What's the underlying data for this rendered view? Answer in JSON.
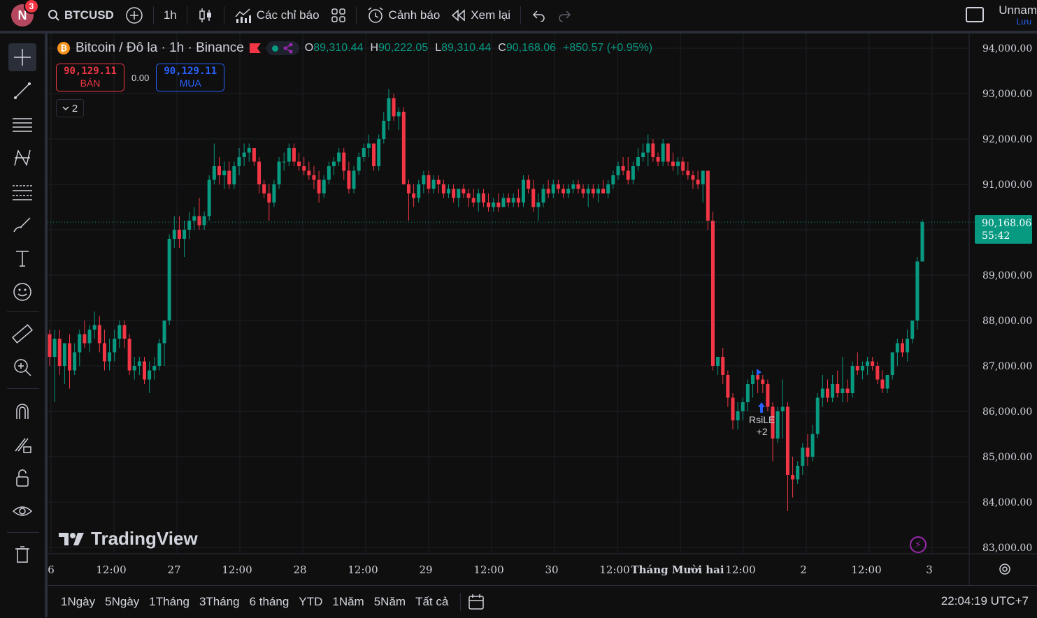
{
  "topbar": {
    "avatar_letter": "N",
    "notif_count": "3",
    "symbol": "BTCUSD",
    "interval": "1h",
    "indicators_label": "Các chỉ báo",
    "alerts_label": "Cảnh báo",
    "replay_label": "Xem lại",
    "user_name": "Unnam",
    "save_label": "Lưu"
  },
  "legend": {
    "title": "Bitcoin / Đô la · 1h · Binance",
    "logo_letter": "₿",
    "o_key": "O",
    "o_val": "89,310.44",
    "h_key": "H",
    "h_val": "90,222.05",
    "l_key": "L",
    "l_val": "89,310.44",
    "c_key": "C",
    "c_val": "90,168.06",
    "change": "+850.57 (+0.95%)"
  },
  "trade": {
    "sell_price": "90,129.11",
    "sell_label": "BÁN",
    "spread": "0.00",
    "buy_price": "90,129.11",
    "buy_label": "MUA",
    "collapse_count": "2"
  },
  "price_axis": [
    "94,000.00",
    "93,000.00",
    "92,000.00",
    "91,000.00",
    "89,000.00",
    "88,000.00",
    "87,000.00",
    "86,000.00",
    "85,000.00",
    "84,000.00",
    "83,000.00"
  ],
  "last_price": {
    "price": "90,168.06",
    "countdown": "55:42"
  },
  "time_axis": [
    "6",
    "12:00",
    "27",
    "12:00",
    "28",
    "12:00",
    "29",
    "12:00",
    "30",
    "12:00",
    "Tháng Mười hai",
    "12:00",
    "2",
    "12:00",
    "3"
  ],
  "strategy_label": {
    "name": "RsiLE",
    "more": "+2"
  },
  "watermark": "TradingView",
  "ranges": [
    "1Ngày",
    "5Ngày",
    "1Tháng",
    "3Tháng",
    "6 tháng",
    "YTD",
    "1Năm",
    "5Năm",
    "Tất cả"
  ],
  "clock": "22:04:19 UTC+7",
  "colors": {
    "up": "#089981",
    "down": "#f23645",
    "accent": "#2962ff",
    "background": "#0f0f0f"
  },
  "chart_data": {
    "type": "candlestick",
    "ylim": [
      82800,
      94300
    ],
    "series": [
      {
        "o": 87700,
        "h": 87800,
        "l": 87000,
        "c": 87200
      },
      {
        "o": 87200,
        "h": 87800,
        "l": 86200,
        "c": 87600
      },
      {
        "o": 87600,
        "h": 87800,
        "l": 86800,
        "c": 87000
      },
      {
        "o": 87000,
        "h": 87400,
        "l": 86600,
        "c": 87500
      },
      {
        "o": 87500,
        "h": 87700,
        "l": 86500,
        "c": 86900
      },
      {
        "o": 86900,
        "h": 87500,
        "l": 86800,
        "c": 87300
      },
      {
        "o": 87300,
        "h": 87800,
        "l": 87000,
        "c": 87700
      },
      {
        "o": 87700,
        "h": 88000,
        "l": 87400,
        "c": 87500
      },
      {
        "o": 87500,
        "h": 87900,
        "l": 87300,
        "c": 87800
      },
      {
        "o": 87800,
        "h": 88200,
        "l": 87600,
        "c": 87900
      },
      {
        "o": 87900,
        "h": 88100,
        "l": 87300,
        "c": 87500
      },
      {
        "o": 87500,
        "h": 87800,
        "l": 86900,
        "c": 87100
      },
      {
        "o": 87100,
        "h": 87600,
        "l": 86900,
        "c": 87300
      },
      {
        "o": 87300,
        "h": 87800,
        "l": 87100,
        "c": 87600
      },
      {
        "o": 87600,
        "h": 88000,
        "l": 87400,
        "c": 87900
      },
      {
        "o": 87900,
        "h": 88000,
        "l": 87400,
        "c": 87600
      },
      {
        "o": 87600,
        "h": 87700,
        "l": 86800,
        "c": 86900
      },
      {
        "o": 86900,
        "h": 87200,
        "l": 86700,
        "c": 87000
      },
      {
        "o": 87000,
        "h": 87200,
        "l": 86800,
        "c": 87100
      },
      {
        "o": 87100,
        "h": 87200,
        "l": 86600,
        "c": 86700
      },
      {
        "o": 86700,
        "h": 87100,
        "l": 86400,
        "c": 86900
      },
      {
        "o": 86900,
        "h": 87200,
        "l": 86700,
        "c": 87000
      },
      {
        "o": 87000,
        "h": 87600,
        "l": 86900,
        "c": 87500
      },
      {
        "o": 87500,
        "h": 88000,
        "l": 87000,
        "c": 88000
      },
      {
        "o": 88000,
        "h": 89900,
        "l": 87900,
        "c": 89800
      },
      {
        "o": 89800,
        "h": 90300,
        "l": 89600,
        "c": 90000
      },
      {
        "o": 90000,
        "h": 90300,
        "l": 89600,
        "c": 89800
      },
      {
        "o": 89800,
        "h": 90200,
        "l": 89400,
        "c": 90000
      },
      {
        "o": 90000,
        "h": 90400,
        "l": 89800,
        "c": 90200
      },
      {
        "o": 90200,
        "h": 90500,
        "l": 90000,
        "c": 90300
      },
      {
        "o": 90300,
        "h": 90700,
        "l": 90000,
        "c": 90100
      },
      {
        "o": 90100,
        "h": 90400,
        "l": 90000,
        "c": 90300
      },
      {
        "o": 90300,
        "h": 91200,
        "l": 90200,
        "c": 91100
      },
      {
        "o": 91100,
        "h": 91900,
        "l": 91000,
        "c": 91400
      },
      {
        "o": 91400,
        "h": 91600,
        "l": 91000,
        "c": 91200
      },
      {
        "o": 91200,
        "h": 91500,
        "l": 90900,
        "c": 91300
      },
      {
        "o": 91300,
        "h": 91500,
        "l": 90900,
        "c": 91000
      },
      {
        "o": 91000,
        "h": 91500,
        "l": 90900,
        "c": 91400
      },
      {
        "o": 91400,
        "h": 91800,
        "l": 91200,
        "c": 91600
      },
      {
        "o": 91600,
        "h": 91900,
        "l": 91400,
        "c": 91700
      },
      {
        "o": 91700,
        "h": 91900,
        "l": 91500,
        "c": 91800
      },
      {
        "o": 91800,
        "h": 91800,
        "l": 91400,
        "c": 91500
      },
      {
        "o": 91500,
        "h": 91600,
        "l": 90800,
        "c": 91000
      },
      {
        "o": 91000,
        "h": 91100,
        "l": 90700,
        "c": 90800
      },
      {
        "o": 90800,
        "h": 91000,
        "l": 90200,
        "c": 90600
      },
      {
        "o": 90600,
        "h": 91100,
        "l": 90500,
        "c": 91000
      },
      {
        "o": 91000,
        "h": 91600,
        "l": 90900,
        "c": 91500
      },
      {
        "o": 91500,
        "h": 91700,
        "l": 91300,
        "c": 91500
      },
      {
        "o": 91500,
        "h": 91900,
        "l": 91400,
        "c": 91800
      },
      {
        "o": 91800,
        "h": 91900,
        "l": 91400,
        "c": 91500
      },
      {
        "o": 91500,
        "h": 91700,
        "l": 91300,
        "c": 91400
      },
      {
        "o": 91400,
        "h": 91600,
        "l": 91200,
        "c": 91300
      },
      {
        "o": 91300,
        "h": 91500,
        "l": 91100,
        "c": 91200
      },
      {
        "o": 91200,
        "h": 91400,
        "l": 90900,
        "c": 91100
      },
      {
        "o": 91100,
        "h": 91300,
        "l": 90600,
        "c": 90800
      },
      {
        "o": 90800,
        "h": 91200,
        "l": 90700,
        "c": 91100
      },
      {
        "o": 91100,
        "h": 91500,
        "l": 91000,
        "c": 91400
      },
      {
        "o": 91400,
        "h": 91600,
        "l": 91200,
        "c": 91500
      },
      {
        "o": 91500,
        "h": 91800,
        "l": 91400,
        "c": 91700
      },
      {
        "o": 91700,
        "h": 91800,
        "l": 91100,
        "c": 91300
      },
      {
        "o": 91300,
        "h": 91500,
        "l": 90800,
        "c": 90900
      },
      {
        "o": 90900,
        "h": 91400,
        "l": 90800,
        "c": 91300
      },
      {
        "o": 91300,
        "h": 91700,
        "l": 91200,
        "c": 91600
      },
      {
        "o": 91600,
        "h": 91900,
        "l": 91500,
        "c": 91800
      },
      {
        "o": 91800,
        "h": 92100,
        "l": 91600,
        "c": 91900
      },
      {
        "o": 91900,
        "h": 91900,
        "l": 91300,
        "c": 91400
      },
      {
        "o": 91400,
        "h": 92100,
        "l": 91300,
        "c": 92000
      },
      {
        "o": 92000,
        "h": 92600,
        "l": 91900,
        "c": 92400
      },
      {
        "o": 92400,
        "h": 93100,
        "l": 92200,
        "c": 92900
      },
      {
        "o": 92900,
        "h": 93000,
        "l": 92400,
        "c": 92500
      },
      {
        "o": 92500,
        "h": 92700,
        "l": 92200,
        "c": 92600
      },
      {
        "o": 92600,
        "h": 92700,
        "l": 91000,
        "c": 91000
      },
      {
        "o": 91000,
        "h": 91100,
        "l": 90200,
        "c": 90800
      },
      {
        "o": 90800,
        "h": 91000,
        "l": 90500,
        "c": 90700
      },
      {
        "o": 90700,
        "h": 91100,
        "l": 90600,
        "c": 91000
      },
      {
        "o": 91000,
        "h": 91300,
        "l": 90800,
        "c": 91200
      },
      {
        "o": 91200,
        "h": 91300,
        "l": 90800,
        "c": 90900
      },
      {
        "o": 90900,
        "h": 91200,
        "l": 90800,
        "c": 91100
      },
      {
        "o": 91100,
        "h": 91200,
        "l": 90800,
        "c": 91000
      },
      {
        "o": 91000,
        "h": 91100,
        "l": 90700,
        "c": 90800
      },
      {
        "o": 90800,
        "h": 91000,
        "l": 90700,
        "c": 90900
      },
      {
        "o": 90900,
        "h": 91000,
        "l": 90600,
        "c": 90700
      },
      {
        "o": 90700,
        "h": 90900,
        "l": 90500,
        "c": 90900
      },
      {
        "o": 90900,
        "h": 91000,
        "l": 90700,
        "c": 90800
      },
      {
        "o": 90800,
        "h": 90900,
        "l": 90500,
        "c": 90700
      },
      {
        "o": 90700,
        "h": 90900,
        "l": 90500,
        "c": 90600
      },
      {
        "o": 90600,
        "h": 90900,
        "l": 90400,
        "c": 90800
      },
      {
        "o": 90800,
        "h": 90900,
        "l": 90500,
        "c": 90600
      },
      {
        "o": 90600,
        "h": 90800,
        "l": 90400,
        "c": 90500
      },
      {
        "o": 90500,
        "h": 90700,
        "l": 90400,
        "c": 90600
      },
      {
        "o": 90600,
        "h": 90800,
        "l": 90400,
        "c": 90500
      },
      {
        "o": 90500,
        "h": 90800,
        "l": 90500,
        "c": 90700
      },
      {
        "o": 90700,
        "h": 90800,
        "l": 90500,
        "c": 90600
      },
      {
        "o": 90600,
        "h": 90800,
        "l": 90500,
        "c": 90700
      },
      {
        "o": 90700,
        "h": 90900,
        "l": 90500,
        "c": 90600
      },
      {
        "o": 90600,
        "h": 91200,
        "l": 90500,
        "c": 91100
      },
      {
        "o": 91100,
        "h": 91200,
        "l": 90800,
        "c": 90900
      },
      {
        "o": 90900,
        "h": 91100,
        "l": 90400,
        "c": 90500
      },
      {
        "o": 90500,
        "h": 90800,
        "l": 90200,
        "c": 90600
      },
      {
        "o": 90600,
        "h": 91000,
        "l": 90500,
        "c": 90900
      },
      {
        "o": 90900,
        "h": 91100,
        "l": 90700,
        "c": 90800
      },
      {
        "o": 90800,
        "h": 91100,
        "l": 90700,
        "c": 91000
      },
      {
        "o": 91000,
        "h": 91100,
        "l": 90800,
        "c": 90900
      },
      {
        "o": 90900,
        "h": 91000,
        "l": 90700,
        "c": 90800
      },
      {
        "o": 90800,
        "h": 91000,
        "l": 90700,
        "c": 90900
      },
      {
        "o": 90900,
        "h": 91100,
        "l": 90800,
        "c": 91000
      },
      {
        "o": 91000,
        "h": 91100,
        "l": 90800,
        "c": 90900
      },
      {
        "o": 90900,
        "h": 91000,
        "l": 90700,
        "c": 90800
      },
      {
        "o": 90800,
        "h": 91000,
        "l": 90500,
        "c": 90900
      },
      {
        "o": 90900,
        "h": 91000,
        "l": 90700,
        "c": 90800
      },
      {
        "o": 90800,
        "h": 91000,
        "l": 90600,
        "c": 90900
      },
      {
        "o": 90900,
        "h": 91100,
        "l": 90800,
        "c": 90800
      },
      {
        "o": 90800,
        "h": 91100,
        "l": 90700,
        "c": 91000
      },
      {
        "o": 91000,
        "h": 91300,
        "l": 90900,
        "c": 91200
      },
      {
        "o": 91200,
        "h": 91500,
        "l": 91100,
        "c": 91400
      },
      {
        "o": 91400,
        "h": 91600,
        "l": 91200,
        "c": 91300
      },
      {
        "o": 91300,
        "h": 91600,
        "l": 91000,
        "c": 91100
      },
      {
        "o": 91100,
        "h": 91500,
        "l": 91000,
        "c": 91400
      },
      {
        "o": 91400,
        "h": 91800,
        "l": 91300,
        "c": 91600
      },
      {
        "o": 91600,
        "h": 91900,
        "l": 91500,
        "c": 91700
      },
      {
        "o": 91700,
        "h": 92100,
        "l": 91400,
        "c": 91900
      },
      {
        "o": 91900,
        "h": 92000,
        "l": 91500,
        "c": 91600
      },
      {
        "o": 91600,
        "h": 91700,
        "l": 91400,
        "c": 91500
      },
      {
        "o": 91500,
        "h": 92000,
        "l": 91400,
        "c": 91900
      },
      {
        "o": 91900,
        "h": 91900,
        "l": 91400,
        "c": 91500
      },
      {
        "o": 91500,
        "h": 91700,
        "l": 91300,
        "c": 91400
      },
      {
        "o": 91400,
        "h": 91600,
        "l": 91200,
        "c": 91500
      },
      {
        "o": 91500,
        "h": 91600,
        "l": 91200,
        "c": 91300
      },
      {
        "o": 91300,
        "h": 91500,
        "l": 91100,
        "c": 91200
      },
      {
        "o": 91200,
        "h": 91300,
        "l": 90900,
        "c": 91100
      },
      {
        "o": 91100,
        "h": 91300,
        "l": 90900,
        "c": 91000
      },
      {
        "o": 91000,
        "h": 91200,
        "l": 90600,
        "c": 91300
      },
      {
        "o": 91300,
        "h": 91300,
        "l": 90000,
        "c": 90200
      },
      {
        "o": 90200,
        "h": 90400,
        "l": 86900,
        "c": 87000
      },
      {
        "o": 87000,
        "h": 87200,
        "l": 86800,
        "c": 87200
      },
      {
        "o": 87200,
        "h": 87400,
        "l": 86600,
        "c": 86800
      },
      {
        "o": 86800,
        "h": 86900,
        "l": 86100,
        "c": 86300
      },
      {
        "o": 86300,
        "h": 86400,
        "l": 85600,
        "c": 85800
      },
      {
        "o": 85800,
        "h": 86200,
        "l": 85600,
        "c": 86000
      },
      {
        "o": 86000,
        "h": 86300,
        "l": 85800,
        "c": 86200
      },
      {
        "o": 86200,
        "h": 86700,
        "l": 86000,
        "c": 86600
      },
      {
        "o": 86600,
        "h": 86900,
        "l": 86300,
        "c": 86800
      },
      {
        "o": 86800,
        "h": 86900,
        "l": 86400,
        "c": 86700
      },
      {
        "o": 86700,
        "h": 86800,
        "l": 86400,
        "c": 86600
      },
      {
        "o": 86600,
        "h": 86700,
        "l": 86000,
        "c": 86100
      },
      {
        "o": 86100,
        "h": 86200,
        "l": 84900,
        "c": 85400
      },
      {
        "o": 85400,
        "h": 86100,
        "l": 85300,
        "c": 86000
      },
      {
        "o": 86000,
        "h": 86700,
        "l": 85400,
        "c": 86100
      },
      {
        "o": 86100,
        "h": 86200,
        "l": 83800,
        "c": 84600
      },
      {
        "o": 84600,
        "h": 85000,
        "l": 84100,
        "c": 84500
      },
      {
        "o": 84500,
        "h": 84900,
        "l": 84400,
        "c": 84800
      },
      {
        "o": 84800,
        "h": 85300,
        "l": 84600,
        "c": 85200
      },
      {
        "o": 85200,
        "h": 85500,
        "l": 84800,
        "c": 85000
      },
      {
        "o": 85000,
        "h": 85700,
        "l": 84900,
        "c": 85500
      },
      {
        "o": 85500,
        "h": 86400,
        "l": 85400,
        "c": 86300
      },
      {
        "o": 86300,
        "h": 86800,
        "l": 86100,
        "c": 86500
      },
      {
        "o": 86500,
        "h": 86700,
        "l": 86200,
        "c": 86300
      },
      {
        "o": 86300,
        "h": 86800,
        "l": 86200,
        "c": 86600
      },
      {
        "o": 86600,
        "h": 86900,
        "l": 86300,
        "c": 86400
      },
      {
        "o": 86400,
        "h": 87200,
        "l": 86200,
        "c": 86500
      },
      {
        "o": 86500,
        "h": 86700,
        "l": 86200,
        "c": 86400
      },
      {
        "o": 86400,
        "h": 87100,
        "l": 86300,
        "c": 87000
      },
      {
        "o": 87000,
        "h": 87300,
        "l": 86800,
        "c": 86900
      },
      {
        "o": 86900,
        "h": 87100,
        "l": 86700,
        "c": 87000
      },
      {
        "o": 87000,
        "h": 87200,
        "l": 86800,
        "c": 87100
      },
      {
        "o": 87100,
        "h": 87200,
        "l": 86900,
        "c": 87000
      },
      {
        "o": 87000,
        "h": 87100,
        "l": 86600,
        "c": 86700
      },
      {
        "o": 86700,
        "h": 86900,
        "l": 86400,
        "c": 86500
      },
      {
        "o": 86500,
        "h": 86800,
        "l": 86400,
        "c": 86800
      },
      {
        "o": 86800,
        "h": 87300,
        "l": 86700,
        "c": 87300
      },
      {
        "o": 87300,
        "h": 87600,
        "l": 87000,
        "c": 87500
      },
      {
        "o": 87500,
        "h": 87600,
        "l": 87200,
        "c": 87300
      },
      {
        "o": 87300,
        "h": 87800,
        "l": 87100,
        "c": 87600
      },
      {
        "o": 87600,
        "h": 88000,
        "l": 87500,
        "c": 88000
      },
      {
        "o": 88000,
        "h": 89400,
        "l": 87800,
        "c": 89300
      },
      {
        "o": 89300,
        "h": 90222,
        "l": 89300,
        "c": 90168
      }
    ]
  }
}
